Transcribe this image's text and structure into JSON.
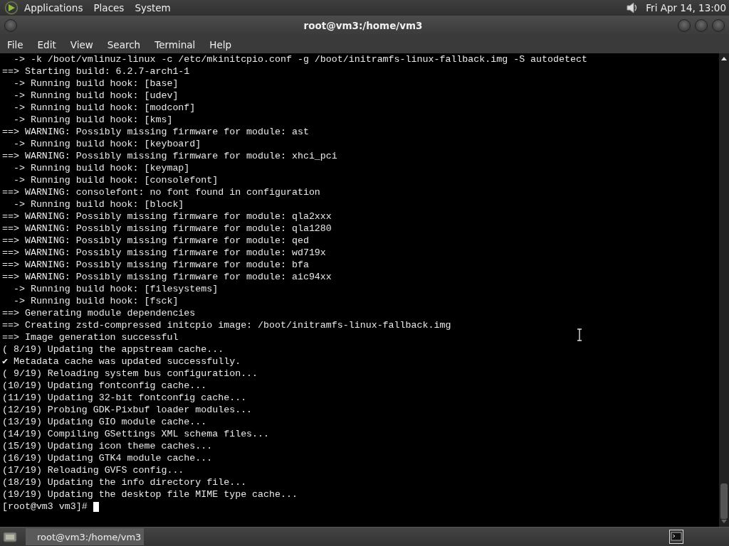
{
  "top_panel": {
    "menus": [
      "Applications",
      "Places",
      "System"
    ],
    "clock": "Fri Apr 14, 13:00"
  },
  "window": {
    "title": "root@vm3:/home/vm3"
  },
  "menubar": [
    "File",
    "Edit",
    "View",
    "Search",
    "Terminal",
    "Help"
  ],
  "terminal": {
    "lines": [
      "  -> -k /boot/vmlinuz-linux -c /etc/mkinitcpio.conf -g /boot/initramfs-linux-fallback.img -S autodetect",
      "==> Starting build: 6.2.7-arch1-1",
      "  -> Running build hook: [base]",
      "  -> Running build hook: [udev]",
      "  -> Running build hook: [modconf]",
      "  -> Running build hook: [kms]",
      "==> WARNING: Possibly missing firmware for module: ast",
      "  -> Running build hook: [keyboard]",
      "==> WARNING: Possibly missing firmware for module: xhci_pci",
      "  -> Running build hook: [keymap]",
      "  -> Running build hook: [consolefont]",
      "==> WARNING: consolefont: no font found in configuration",
      "  -> Running build hook: [block]",
      "==> WARNING: Possibly missing firmware for module: qla2xxx",
      "==> WARNING: Possibly missing firmware for module: qla1280",
      "==> WARNING: Possibly missing firmware for module: qed",
      "==> WARNING: Possibly missing firmware for module: wd719x",
      "==> WARNING: Possibly missing firmware for module: bfa",
      "==> WARNING: Possibly missing firmware for module: aic94xx",
      "  -> Running build hook: [filesystems]",
      "  -> Running build hook: [fsck]",
      "==> Generating module dependencies",
      "==> Creating zstd-compressed initcpio image: /boot/initramfs-linux-fallback.img",
      "==> Image generation successful",
      "( 8/19) Updating the appstream cache...",
      "✔ Metadata cache was updated successfully.",
      "( 9/19) Reloading system bus configuration...",
      "(10/19) Updating fontconfig cache...",
      "(11/19) Updating 32-bit fontconfig cache...",
      "(12/19) Probing GDK-Pixbuf loader modules...",
      "(13/19) Updating GIO module cache...",
      "(14/19) Compiling GSettings XML schema files...",
      "(15/19) Updating icon theme caches...",
      "(16/19) Updating GTK4 module cache...",
      "(17/19) Reloading GVFS config...",
      "(18/19) Updating the info directory file...",
      "(19/19) Updating the desktop file MIME type cache..."
    ],
    "prompt": "[root@vm3 vm3]#"
  },
  "taskbar": {
    "tasks": [
      {
        "label": "root@vm3:/home/vm3",
        "selected": true
      }
    ]
  }
}
